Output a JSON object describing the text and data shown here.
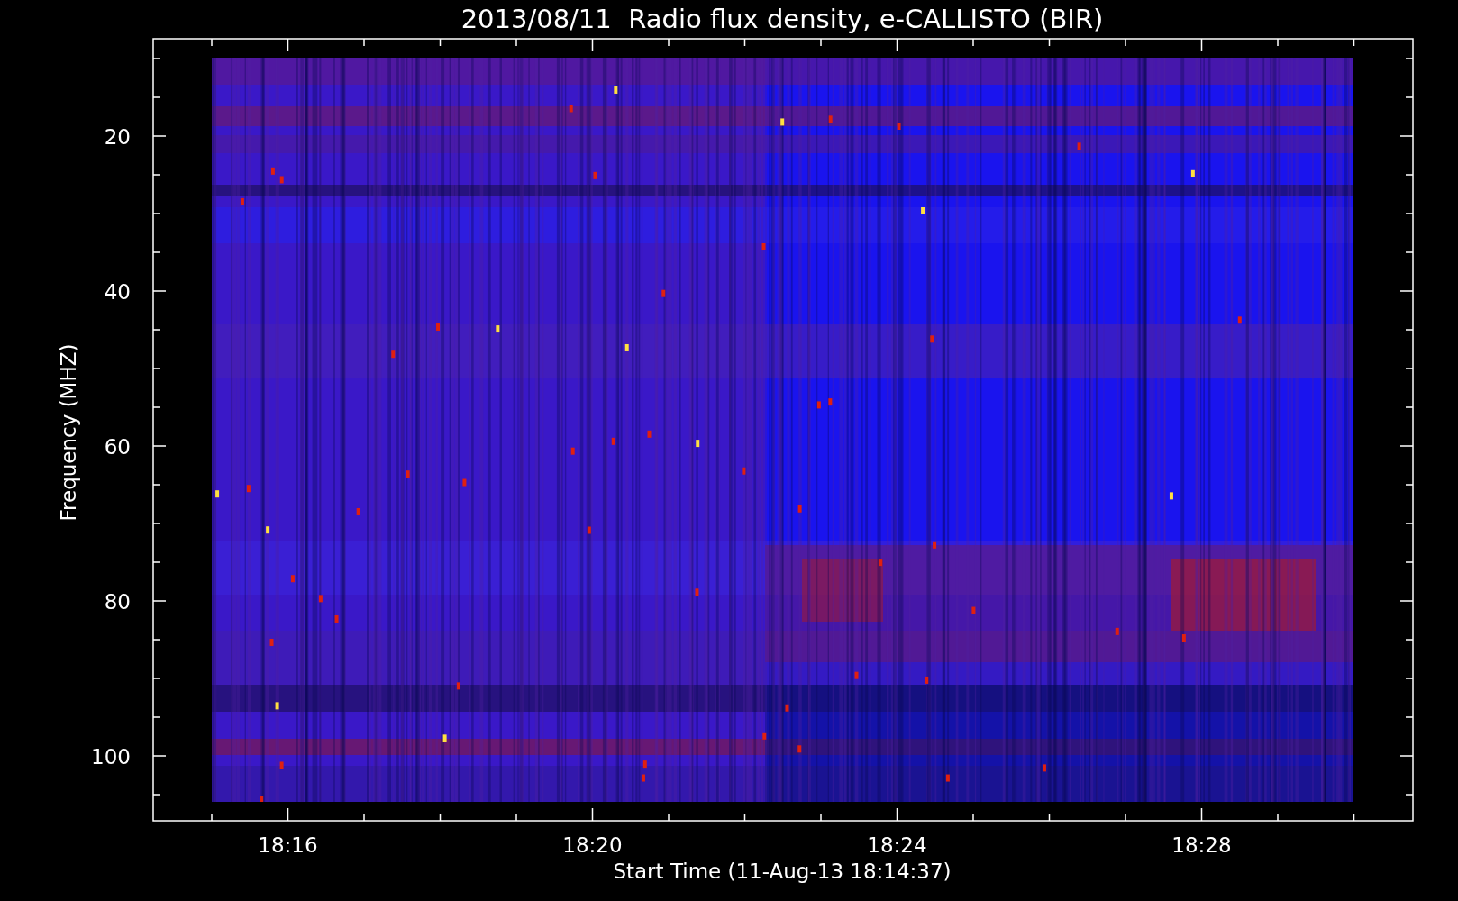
{
  "plot": {
    "title": "2013/08/11  Radio flux density, e-CALLISTO (BIR)",
    "ylabel": "Frequency (MHZ)",
    "xlabel": "Start Time (11-Aug-13 18:14:37)",
    "yticks": [
      "20",
      "40",
      "60",
      "80",
      "100"
    ],
    "xticks": [
      "18:16",
      "18:20",
      "18:24",
      "18:28"
    ]
  }
}
